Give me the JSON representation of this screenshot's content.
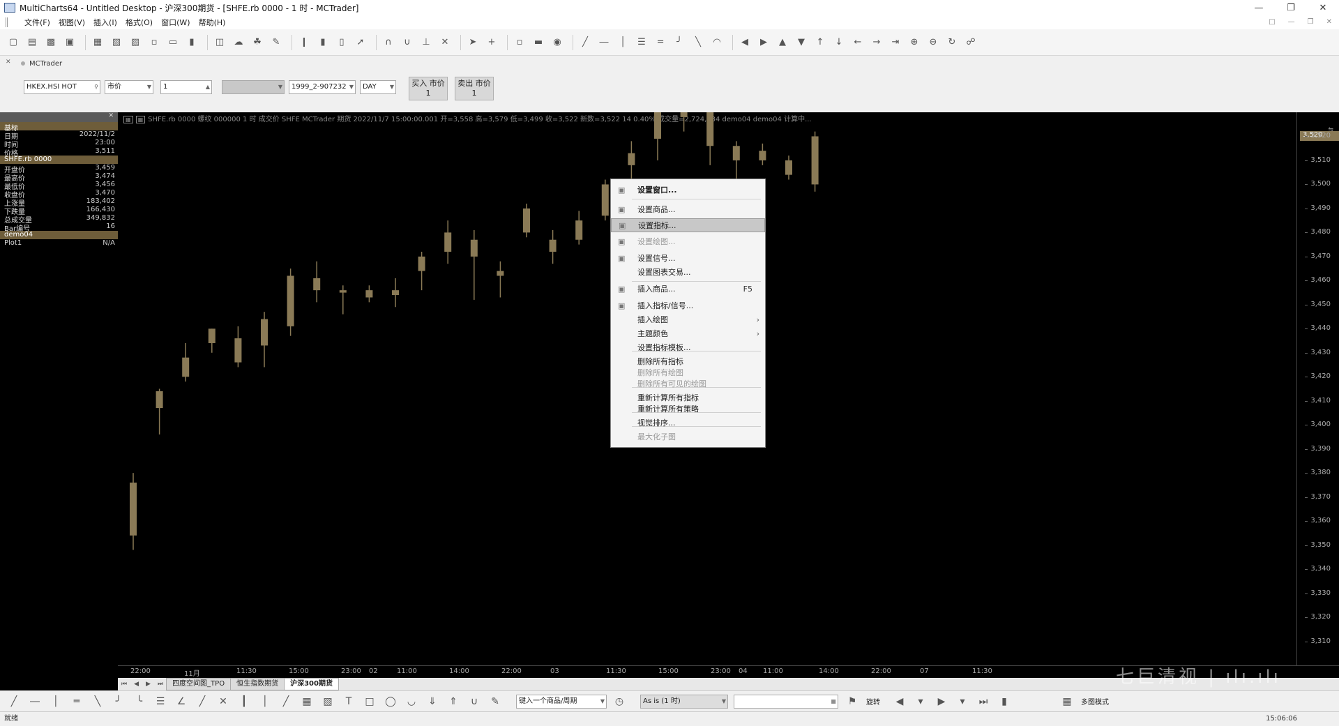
{
  "window": {
    "title": "MultiCharts64 - Untitled Desktop - 沪深300期货 - [SHFE.rb 0000 - 1 时 - MCTrader]"
  },
  "menu": [
    "文件(F)",
    "视图(V)",
    "插入(I)",
    "格式(O)",
    "窗口(W)",
    "帮助(H)"
  ],
  "trade_bar": {
    "tab_label": "MCTrader",
    "symbol": "HKEX.HSI HOT",
    "order_type": "市价",
    "quantity": "1",
    "account": "1999_2-907232",
    "tif": "DAY",
    "buy_label": "买入 市价",
    "buy_qty": "1",
    "sell_label": "卖出 市价",
    "sell_qty": "1"
  },
  "data_window": {
    "header": "",
    "rows": [
      {
        "label": "基标",
        "value": "",
        "group": true
      },
      {
        "label": "日期",
        "value": "2022/11/2"
      },
      {
        "label": "时间",
        "value": "23:00"
      },
      {
        "label": "价格",
        "value": "3,511"
      },
      {
        "label": "SHFE.rb 0000",
        "value": "",
        "group": true
      },
      {
        "label": "开盘价",
        "value": "3,459"
      },
      {
        "label": "最高价",
        "value": "3,474"
      },
      {
        "label": "最低价",
        "value": "3,456"
      },
      {
        "label": "收盘价",
        "value": "3,470"
      },
      {
        "label": "上涨量",
        "value": "183,402"
      },
      {
        "label": "下跌量",
        "value": "166,430"
      },
      {
        "label": "总成交量",
        "value": "349,832"
      },
      {
        "label": "Bar编号",
        "value": "16"
      },
      {
        "label": "demo04",
        "value": "",
        "group": true
      },
      {
        "label": "Plot1",
        "value": "N/A"
      }
    ]
  },
  "status_line": "SHFE.rb 0000  螺纹 000000 1 时  成交价  SHFE  MCTrader  期货  2022/11/7  15:00:00.001  开=3,558  高=3,579  低=3,499  收=3,522  新数=3,522  14  0.40%  成交量=2,724,034  demo04   demo04 计算中...",
  "price_axis": [
    "3,520",
    "3,510",
    "3,500",
    "3,490",
    "3,480",
    "3,470",
    "3,460",
    "3,450",
    "3,440",
    "3,430",
    "3,420",
    "3,410",
    "3,400",
    "3,390",
    "3,380",
    "3,370",
    "3,360",
    "3,350",
    "3,340",
    "3,330",
    "3,320",
    "3,310"
  ],
  "current_price": "3,520",
  "time_axis": [
    "22:00",
    "11月",
    "11:30",
    "15:00",
    "23:00",
    "02",
    "11:00",
    "14:00",
    "22:00",
    "03",
    "11:30",
    "15:00",
    "23:00",
    "04",
    "11:00",
    "14:00",
    "22:00",
    "07",
    "11:30"
  ],
  "sheet_tabs": [
    {
      "label": "四度空间图_TPO",
      "active": false
    },
    {
      "label": "恒生指数期货",
      "active": false
    },
    {
      "label": "沪深300期货",
      "active": true
    }
  ],
  "context_menu": [
    {
      "label": "设置窗口...",
      "bold": true,
      "icon": "window-icon"
    },
    {
      "label": "设置商品...",
      "icon": "instrument-icon"
    },
    {
      "label": "设置指标...",
      "icon": "indicator-icon",
      "highlight": true
    },
    {
      "label": "设置绘图...",
      "icon": "drawing-icon",
      "disabled": true
    },
    {
      "label": "设置信号...",
      "icon": "signal-icon"
    },
    {
      "label": "设置图表交易..."
    },
    {
      "label": "插入商品...",
      "shortcut": "F5",
      "icon": "insert-instrument-icon"
    },
    {
      "label": "插入指标/信号...",
      "icon": "insert-indicator-icon"
    },
    {
      "label": "插入绘图",
      "submenu": true
    },
    {
      "label": "主题颜色",
      "submenu": true
    },
    {
      "label": "设置指标模板..."
    },
    {
      "label": "删除所有指标"
    },
    {
      "label": "删除所有绘图",
      "disabled": true
    },
    {
      "label": "删除所有可见的绘图",
      "disabled": true
    },
    {
      "label": "重新计算所有指标"
    },
    {
      "label": "重新计算所有策略"
    },
    {
      "label": "视觉排序..."
    },
    {
      "label": "最大化子图",
      "disabled": true
    }
  ],
  "drawing_bar": {
    "symbol_period_placeholder": "键入一个商品/周期",
    "as_is": "As is (1 时)",
    "rotate_label": "旋转",
    "multi_chart": "多图模式"
  },
  "status_bar": {
    "text": "就绪",
    "clock": "15:06:06"
  },
  "watermark": "七巨清视 | ılı.ılı",
  "chart_data": {
    "type": "candlestick",
    "symbol": "SHFE.rb 0000",
    "candles": [
      {
        "o": 3354,
        "h": 3380,
        "l": 3348,
        "c": 3376
      },
      {
        "o": 3407,
        "h": 3415,
        "l": 3396,
        "c": 3414
      },
      {
        "o": 3428,
        "h": 3434,
        "l": 3418,
        "c": 3420
      },
      {
        "o": 3434,
        "h": 3440,
        "l": 3430,
        "c": 3440
      },
      {
        "o": 3436,
        "h": 3441,
        "l": 3424,
        "c": 3426
      },
      {
        "o": 3444,
        "h": 3447,
        "l": 3424,
        "c": 3433
      },
      {
        "o": 3462,
        "h": 3465,
        "l": 3437,
        "c": 3441
      },
      {
        "o": 3461,
        "h": 3468,
        "l": 3451,
        "c": 3456
      },
      {
        "o": 3456,
        "h": 3458,
        "l": 3446,
        "c": 3455
      },
      {
        "o": 3453,
        "h": 3458,
        "l": 3451,
        "c": 3456
      },
      {
        "o": 3456,
        "h": 3461,
        "l": 3449,
        "c": 3454
      },
      {
        "o": 3470,
        "h": 3472,
        "l": 3456,
        "c": 3464
      },
      {
        "o": 3480,
        "h": 3485,
        "l": 3467,
        "c": 3472
      },
      {
        "o": 3477,
        "h": 3481,
        "l": 3452,
        "c": 3470
      },
      {
        "o": 3464,
        "h": 3468,
        "l": 3453,
        "c": 3462
      },
      {
        "o": 3490,
        "h": 3492,
        "l": 3478,
        "c": 3480
      },
      {
        "o": 3477,
        "h": 3481,
        "l": 3467,
        "c": 3472
      },
      {
        "o": 3485,
        "h": 3489,
        "l": 3475,
        "c": 3477
      },
      {
        "o": 3500,
        "h": 3502,
        "l": 3485,
        "c": 3487
      },
      {
        "o": 3513,
        "h": 3518,
        "l": 3497,
        "c": 3508
      },
      {
        "o": 3535,
        "h": 3540,
        "l": 3510,
        "c": 3519
      },
      {
        "o": 3530,
        "h": 3545,
        "l": 3522,
        "c": 3528
      },
      {
        "o": 3535,
        "h": 3540,
        "l": 3508,
        "c": 3516
      },
      {
        "o": 3516,
        "h": 3518,
        "l": 3501,
        "c": 3510
      },
      {
        "o": 3514,
        "h": 3517,
        "l": 3508,
        "c": 3510
      },
      {
        "o": 3510,
        "h": 3512,
        "l": 3502,
        "c": 3504
      },
      {
        "o": 3520,
        "h": 3522,
        "l": 3497,
        "c": 3500
      }
    ],
    "ylim": [
      3300,
      3530
    ]
  }
}
